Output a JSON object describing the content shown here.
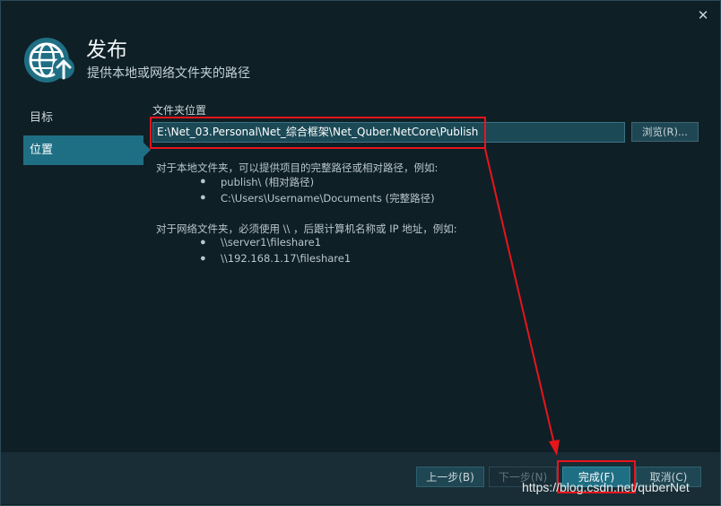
{
  "window": {
    "close_symbol": "✕",
    "title": "发布",
    "subtitle": "提供本地或网络文件夹的路径",
    "header_icon": "globe-upload-icon"
  },
  "sidebar": {
    "items": [
      {
        "label": "目标",
        "selected": false
      },
      {
        "label": "位置",
        "selected": true
      }
    ]
  },
  "location": {
    "label": "文件夹位置",
    "path_value": "E:\\Net_03.Personal\\Net_综合框架\\Net_Quber.NetCore\\Publish",
    "browse_label": "浏览(R)...",
    "local_hint": "对于本地文件夹，可以提供项目的完整路径或相对路径，例如:",
    "local_examples": [
      "publish\\ (相对路径)",
      "C:\\Users\\Username\\Documents (完整路径)"
    ],
    "network_hint": "对于网络文件夹，必须使用 \\\\ ，后跟计算机名称或 IP 地址，例如:",
    "network_examples": [
      "\\\\server1\\fileshare1",
      "\\\\192.168.1.17\\fileshare1"
    ],
    "bullet": "●"
  },
  "footer": {
    "prev_label": "上一步(B)",
    "next_label": "下一步(N)",
    "finish_label": "完成(F)",
    "cancel_label": "取消(C)"
  },
  "annotation": {
    "color": "#e8141b"
  },
  "watermark": "https://blog.csdn.net/quberNet"
}
